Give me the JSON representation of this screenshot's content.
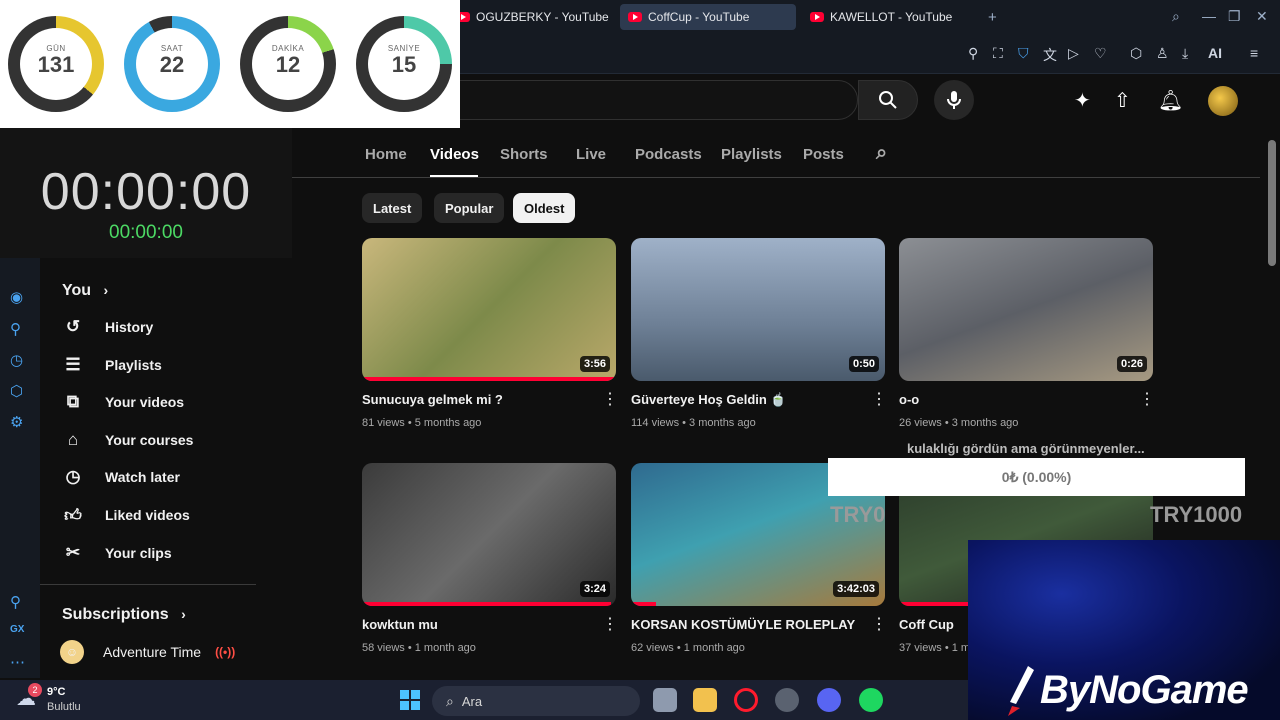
{
  "browser": {
    "tabs": [
      {
        "label": "OGUZBERKY - YouTube",
        "active": false
      },
      {
        "label": "CoffCup - YouTube",
        "active": true
      },
      {
        "label": "KAWELLOT - YouTube",
        "active": false
      }
    ],
    "new_tab": "+",
    "toolbar_ai_label": "AI"
  },
  "countdown": {
    "units": [
      {
        "label": "GÜN",
        "value": "131",
        "fraction": 0.36,
        "color": "#e6c62f"
      },
      {
        "label": "SAAT",
        "value": "22",
        "fraction": 0.92,
        "color": "#3aa8e0"
      },
      {
        "label": "DAKİKA",
        "value": "12",
        "fraction": 0.2,
        "color": "#8bd44a"
      },
      {
        "label": "SANİYE",
        "value": "15",
        "fraction": 0.25,
        "color": "#4ec9a8"
      }
    ],
    "ring_track_color": "#333333"
  },
  "stopwatch": {
    "main": "00:00:00",
    "sub": "00:00:00"
  },
  "guide": {
    "you_label": "You",
    "items": [
      {
        "label": "History",
        "icon": "history-icon"
      },
      {
        "label": "Playlists",
        "icon": "playlists-icon"
      },
      {
        "label": "Your videos",
        "icon": "your-videos-icon"
      },
      {
        "label": "Your courses",
        "icon": "courses-icon"
      },
      {
        "label": "Watch later",
        "icon": "watch-later-icon"
      },
      {
        "label": "Liked videos",
        "icon": "thumbs-up-icon"
      },
      {
        "label": "Your clips",
        "icon": "scissors-icon"
      }
    ],
    "subscriptions_label": "Subscriptions",
    "subscriptions": [
      {
        "label": "Adventure Time",
        "live": true
      }
    ]
  },
  "channel_tabs": [
    "Home",
    "Videos",
    "Shorts",
    "Live",
    "Podcasts",
    "Playlists",
    "Posts"
  ],
  "active_tab": "Videos",
  "chips": [
    {
      "label": "Latest",
      "selected": false
    },
    {
      "label": "Popular",
      "selected": false
    },
    {
      "label": "Oldest",
      "selected": true
    }
  ],
  "videos": [
    {
      "title": "Sunucuya gelmek mi ?",
      "meta": "81 views • 5 months ago",
      "duration": "3:56",
      "progress": 1.0,
      "thumb": "linear-gradient(135deg,#c9b77c,#7d8a4a 50%,#b9a86a)"
    },
    {
      "title": "Güverteye Hoş Geldin 🍵",
      "meta": "114 views • 3 months ago",
      "duration": "0:50",
      "progress": 0,
      "thumb": "linear-gradient(180deg,#9fb1c8,#6e8096 60%,#4a5a6c)"
    },
    {
      "title": "o-o",
      "meta": "26 views • 3 months ago",
      "duration": "0:26",
      "progress": 0,
      "thumb": "linear-gradient(160deg,#8c8f94,#5c5f66 50%,#a79a82)"
    },
    {
      "title": "kowktun mu",
      "meta": "58 views • 1 month ago",
      "duration": "3:24",
      "progress": 0.98,
      "thumb": "linear-gradient(135deg,#3b3b3b,#6a6a6a 50%,#2a2a2a)"
    },
    {
      "title": "KORSAN KOSTÜMÜYLE ROLEPLAY",
      "meta": "62 views • 1 month ago",
      "duration": "3:42:03",
      "progress": 0.1,
      "thumb": "linear-gradient(160deg,#2f6a8f,#3fa0b0 45%,#a77a3c)"
    },
    {
      "title": "Coff Cup",
      "meta": "37 views • 1 m",
      "duration": "",
      "progress": 0.4,
      "thumb": "linear-gradient(160deg,#2a3a2a,#405a3a 50%,#1a1a1a)"
    }
  ],
  "overlays": {
    "donation_title": "kulaklığı gördün ama görünmeyenler...",
    "donation_amount": "0₺ (0.00%)",
    "goal_label": "TRY1000",
    "goal_label_partial": "TRY0",
    "brand": "ByNoGame"
  },
  "taskbar": {
    "weather_temp": "9°C",
    "weather_desc": "Bulutlu",
    "weather_badge": "2",
    "search_placeholder": "Ara"
  }
}
